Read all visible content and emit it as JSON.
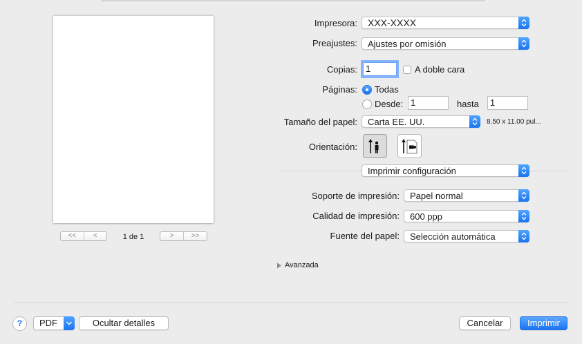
{
  "preview": {
    "page_indicator": "1 de 1",
    "nav_first": "<<",
    "nav_prev": "<",
    "nav_next": ">",
    "nav_last": ">>"
  },
  "printer": {
    "label": "Impresora:",
    "value": "XXX-XXXX"
  },
  "presets": {
    "label": "Preajustes:",
    "value": "Ajustes por omisión"
  },
  "copies": {
    "label": "Copias:",
    "value": "1",
    "duplex_label": "A doble cara",
    "duplex_checked": false
  },
  "pages": {
    "label": "Páginas:",
    "all_label": "Todas",
    "from_label": "Desde:",
    "from_value": "1",
    "to_label": "hasta",
    "to_value": "1",
    "selected": "all"
  },
  "paper_size": {
    "label": "Tamaño del papel:",
    "value": "Carta EE. UU.",
    "dimensions": "8.50 x 11.00 pul..."
  },
  "orientation": {
    "label": "Orientación:",
    "selected": "portrait"
  },
  "section": {
    "value": "Imprimir configuración"
  },
  "media_type": {
    "label": "Soporte de impresión:",
    "value": "Papel normal"
  },
  "quality": {
    "label": "Calidad de impresión:",
    "value": "600 ppp"
  },
  "paper_source": {
    "label": "Fuente del papel:",
    "value": "Selección automática"
  },
  "advanced": {
    "label": "Avanzada"
  },
  "footer": {
    "help": "?",
    "pdf_label": "PDF",
    "hide_details": "Ocultar detalles",
    "cancel": "Cancelar",
    "print": "Imprimir"
  },
  "colors": {
    "accent": "#1a74f0",
    "background": "#ececec"
  }
}
